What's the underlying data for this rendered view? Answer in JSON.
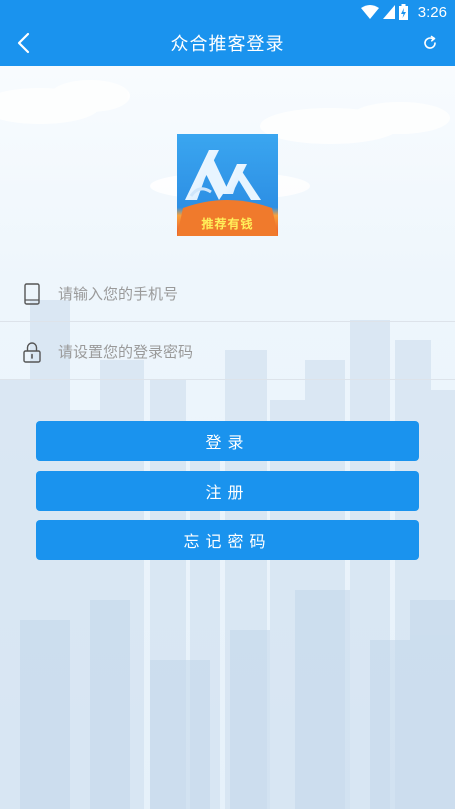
{
  "status_bar": {
    "time": "3:26",
    "icons": [
      "wifi-icon",
      "signal-icon",
      "battery-charging-icon"
    ]
  },
  "app_bar": {
    "title": "众合推客登录",
    "back_icon": "chevron-left-icon",
    "refresh_icon": "refresh-icon"
  },
  "logo": {
    "text": "推荐有钱",
    "colors": {
      "top": "#38a6f0",
      "bottom": "#f0762a",
      "text": "#ffef5a"
    }
  },
  "form": {
    "phone": {
      "placeholder": "请输入您的手机号",
      "value": "",
      "icon": "phone-icon"
    },
    "password": {
      "placeholder": "请设置您的登录密码",
      "value": "",
      "icon": "lock-icon"
    }
  },
  "buttons": {
    "login": "登录",
    "register": "注册",
    "forgot": "忘记密码"
  },
  "colors": {
    "primary": "#1a93ee",
    "divider": "#dde3ea",
    "placeholder": "#9a9a9a"
  }
}
